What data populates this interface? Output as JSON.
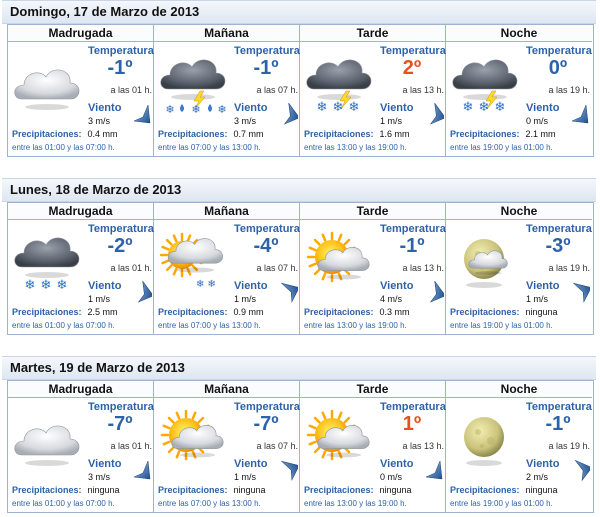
{
  "labels": {
    "temperature": "Temperatura",
    "wind": "Viento",
    "precip": "Precipitaciones:"
  },
  "colors": {
    "cold_temp": "#2e62a8",
    "warm_temp": "#e8501e",
    "header_bg": "#dde6f1",
    "border": "#9db3d1"
  },
  "days": [
    {
      "title": "Domingo, 17 de Marzo de 2013",
      "periods": [
        {
          "name": "Madrugada",
          "icon": "cloudy-icon",
          "temp": "-1º",
          "temp_color": "#2e62a8",
          "temp_at": "a las 01 h.",
          "wind": "3 m/s",
          "wind_dir": "from-south",
          "precip": "0.4 mm",
          "range": "entre las 01:00 y las 07:00 h."
        },
        {
          "name": "Mañana",
          "icon": "storm-snow-rain-icon",
          "temp": "-1º",
          "temp_color": "#2e62a8",
          "temp_at": "a las 07 h.",
          "wind": "3 m/s",
          "wind_dir": "from-southwest",
          "precip": "0.7 mm",
          "range": "entre las 07:00 y las 13:00 h."
        },
        {
          "name": "Tarde",
          "icon": "storm-snow-icon",
          "temp": "2º",
          "temp_color": "#e8501e",
          "temp_at": "a las 13 h.",
          "wind": "1 m/s",
          "wind_dir": "from-southwest",
          "precip": "1.6 mm",
          "range": "entre las 13:00 y las 19:00 h."
        },
        {
          "name": "Noche",
          "icon": "storm-snow-icon",
          "temp": "0º",
          "temp_color": "#2e62a8",
          "temp_at": "a las 19 h.",
          "wind": "0 m/s",
          "wind_dir": "from-south",
          "precip": "2.1 mm",
          "range": "entre las 19:00 y las 01:00 h."
        }
      ]
    },
    {
      "title": "Lunes, 18 de Marzo de 2013",
      "periods": [
        {
          "name": "Madrugada",
          "icon": "cloud-snow-icon",
          "temp": "-2º",
          "temp_color": "#2e62a8",
          "temp_at": "a las 01 h.",
          "wind": "1 m/s",
          "wind_dir": "from-southwest",
          "precip": "2.5 mm",
          "range": "entre las 01:00 y las 07:00 h."
        },
        {
          "name": "Mañana",
          "icon": "sun-cloud-snow-icon",
          "temp": "-4º",
          "temp_color": "#2e62a8",
          "temp_at": "a las 07 h.",
          "wind": "1 m/s",
          "wind_dir": "from-northwest",
          "precip": "0.9 mm",
          "range": "entre las 07:00 y las 13:00 h."
        },
        {
          "name": "Tarde",
          "icon": "sun-cloud-icon",
          "temp": "-1º",
          "temp_color": "#2e62a8",
          "temp_at": "a las 13 h.",
          "wind": "4 m/s",
          "wind_dir": "from-southwest",
          "precip": "0.3 mm",
          "range": "entre las 13:00 y las 19:00 h."
        },
        {
          "name": "Noche",
          "icon": "moon-cloud-icon",
          "temp": "-3º",
          "temp_color": "#2e62a8",
          "temp_at": "a las 19 h.",
          "wind": "1 m/s",
          "wind_dir": "from-northwest",
          "precip": "ninguna",
          "range": "entre las 19:00 y las 01:00 h."
        }
      ]
    },
    {
      "title": "Martes, 19 de Marzo de 2013",
      "periods": [
        {
          "name": "Madrugada",
          "icon": "cloudy-icon",
          "temp": "-7º",
          "temp_color": "#2e62a8",
          "temp_at": "a las 01 h.",
          "wind": "3 m/s",
          "wind_dir": "from-south",
          "precip": "ninguna",
          "range": "entre las 01:00 y las 07:00 h."
        },
        {
          "name": "Mañana",
          "icon": "sun-cloud-icon",
          "temp": "-7º",
          "temp_color": "#2e62a8",
          "temp_at": "a las 07 h.",
          "wind": "1 m/s",
          "wind_dir": "from-northwest",
          "precip": "ninguna",
          "range": "entre las 07:00 y las 13:00 h."
        },
        {
          "name": "Tarde",
          "icon": "sun-cloud-icon",
          "temp": "1º",
          "temp_color": "#e8501e",
          "temp_at": "a las 13 h.",
          "wind": "0 m/s",
          "wind_dir": "from-south",
          "precip": "ninguna",
          "range": "entre las 13:00 y las 19:00 h."
        },
        {
          "name": "Noche",
          "icon": "moon-icon",
          "temp": "-1º",
          "temp_color": "#2e62a8",
          "temp_at": "a las 19 h.",
          "wind": "2 m/s",
          "wind_dir": "from-west",
          "precip": "ninguna",
          "range": "entre las 19:00 y las 01:00 h."
        }
      ]
    }
  ]
}
